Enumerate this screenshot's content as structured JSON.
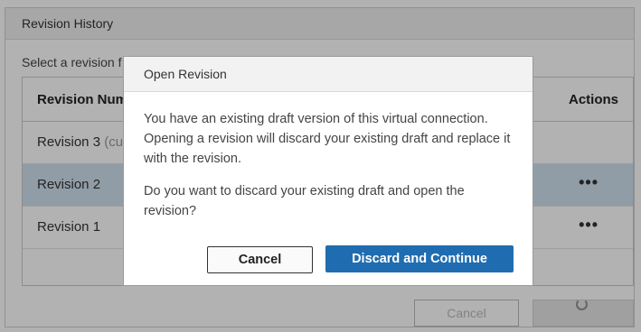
{
  "window": {
    "title": "Revision History"
  },
  "instruction": "Select a revision f",
  "table": {
    "col_revision": "Revision Num",
    "col_actions": "Actions",
    "rows": [
      {
        "name": "Revision 3",
        "suffix": "(cur",
        "actions": ""
      },
      {
        "name": "Revision 2",
        "suffix": "",
        "actions": "•••"
      },
      {
        "name": "Revision 1",
        "suffix": "",
        "actions": "•••"
      }
    ]
  },
  "footer": {
    "cancel_label": "Cancel"
  },
  "dialog": {
    "title": "Open Revision",
    "message1": "You have an existing draft version of this virtual connection. Opening a revision will discard your existing draft and replace it with the revision.",
    "message2": "Do you want to discard your existing draft and open the revision?",
    "cancel_label": "Cancel",
    "primary_label": "Discard and Continue"
  },
  "colors": {
    "primary": "#1f6db0",
    "selected_row": "#cfe1ee"
  }
}
